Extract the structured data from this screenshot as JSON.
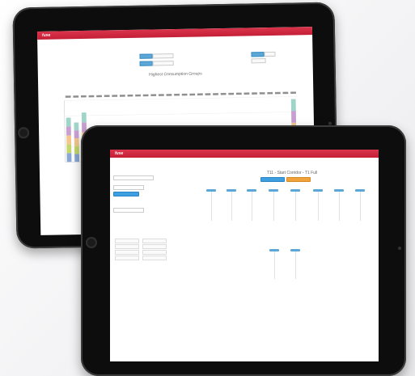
{
  "back_screen": {
    "brand": "fuse",
    "nav": [
      "",
      "",
      ""
    ],
    "chart_data": {
      "type": "bar",
      "title": "Highest Consumption Groups",
      "series": [
        {
          "values": [
            18,
            16,
            20,
            8,
            6,
            5,
            4,
            4,
            4,
            3,
            3,
            3,
            3,
            3,
            3,
            3,
            2,
            2,
            2,
            3,
            4,
            3,
            2,
            2,
            3,
            3,
            2,
            2,
            2,
            24
          ]
        }
      ]
    }
  },
  "front_screen": {
    "brand": "fuse",
    "center_title": "T11 - Start Corridor - T1 Full",
    "colors": {
      "header": "#c41f36",
      "primary": "#3e9fe0",
      "secondary": "#f0a23b"
    }
  },
  "icons": {
    "home_button": "circle",
    "camera": "dot"
  }
}
